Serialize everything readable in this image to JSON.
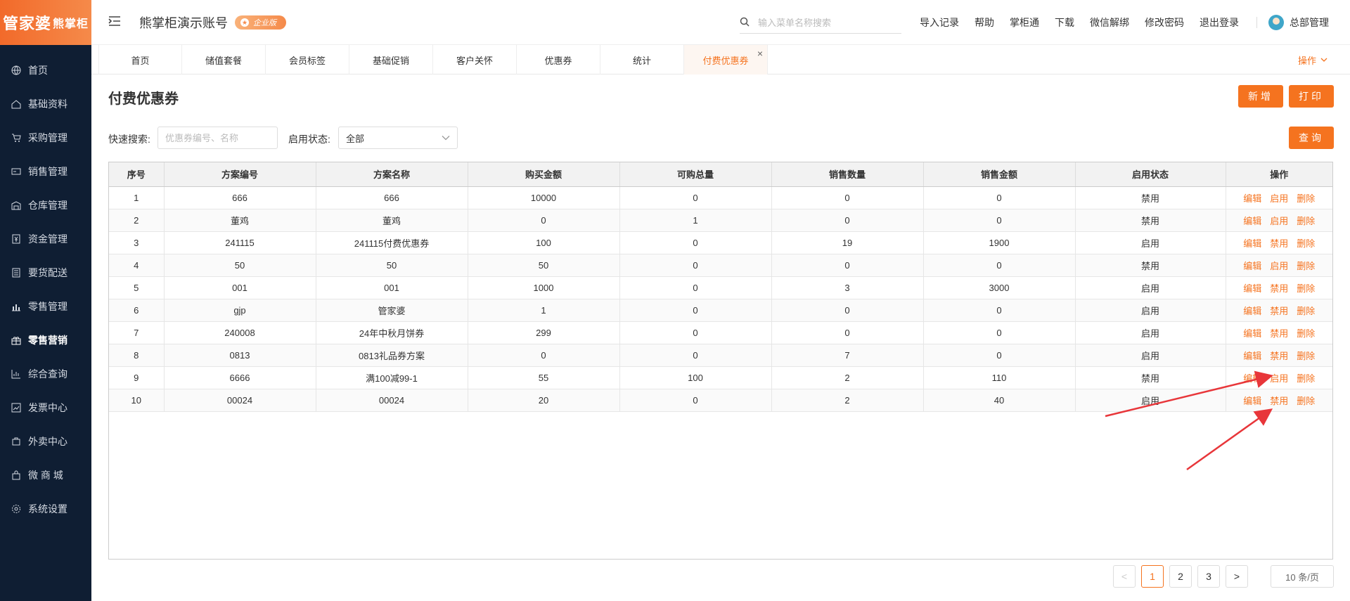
{
  "logo": {
    "main": "管家婆",
    "sub": "熊掌柜"
  },
  "sidebar": {
    "items": [
      {
        "label": "首页",
        "icon": "globe-icon"
      },
      {
        "label": "基础资料",
        "icon": "home-icon"
      },
      {
        "label": "采购管理",
        "icon": "cart-icon"
      },
      {
        "label": "销售管理",
        "icon": "card-icon"
      },
      {
        "label": "仓库管理",
        "icon": "warehouse-icon"
      },
      {
        "label": "资金管理",
        "icon": "money-icon"
      },
      {
        "label": "要货配送",
        "icon": "list-icon"
      },
      {
        "label": "零售管理",
        "icon": "chart-icon"
      },
      {
        "label": "零售营销",
        "icon": "gift-icon",
        "active": true
      },
      {
        "label": "综合查询",
        "icon": "bar-chart-icon"
      },
      {
        "label": "发票中心",
        "icon": "trend-icon"
      },
      {
        "label": "外卖中心",
        "icon": "delivery-icon"
      },
      {
        "label": "微 商 城",
        "icon": "shop-icon"
      },
      {
        "label": "系统设置",
        "icon": "gear-icon"
      }
    ]
  },
  "header": {
    "account": "熊掌柜演示账号",
    "badge": "企业版",
    "search_placeholder": "输入菜单名称搜索",
    "links": [
      "导入记录",
      "帮助",
      "掌柜通",
      "下载",
      "微信解绑",
      "修改密码",
      "退出登录"
    ],
    "user": "总部管理"
  },
  "tabs": {
    "items": [
      "首页",
      "储值套餐",
      "会员标签",
      "基础促销",
      "客户关怀",
      "优惠券",
      "统计",
      "付费优惠券"
    ],
    "active_index": 7,
    "ops_label": "操作"
  },
  "page": {
    "title": "付费优惠券",
    "btn_new": "新增",
    "btn_print": "打印",
    "btn_query": "查询",
    "quick_search_label": "快速搜索:",
    "quick_search_placeholder": "优惠券编号、名称",
    "status_label": "启用状态:",
    "status_value": "全部"
  },
  "table": {
    "headers": [
      "序号",
      "方案编号",
      "方案名称",
      "购买金额",
      "可购总量",
      "销售数量",
      "销售金额",
      "启用状态",
      "操作"
    ],
    "rows": [
      {
        "no": "1",
        "code": "666",
        "name": "666",
        "amount": "10000",
        "total": "0",
        "sold": "0",
        "sales": "0",
        "status": "禁用",
        "actions": [
          "编辑",
          "启用",
          "删除"
        ]
      },
      {
        "no": "2",
        "code": "董鸡",
        "name": "董鸡",
        "amount": "0",
        "total": "1",
        "sold": "0",
        "sales": "0",
        "status": "禁用",
        "actions": [
          "编辑",
          "启用",
          "删除"
        ]
      },
      {
        "no": "3",
        "code": "241115",
        "name": "241115付费优惠券",
        "amount": "100",
        "total": "0",
        "sold": "19",
        "sales": "1900",
        "status": "启用",
        "actions": [
          "编辑",
          "禁用",
          "删除"
        ]
      },
      {
        "no": "4",
        "code": "50",
        "name": "50",
        "amount": "50",
        "total": "0",
        "sold": "0",
        "sales": "0",
        "status": "禁用",
        "actions": [
          "编辑",
          "启用",
          "删除"
        ]
      },
      {
        "no": "5",
        "code": "001",
        "name": "001",
        "amount": "1000",
        "total": "0",
        "sold": "3",
        "sales": "3000",
        "status": "启用",
        "actions": [
          "编辑",
          "禁用",
          "删除"
        ]
      },
      {
        "no": "6",
        "code": "gjp",
        "name": "管家婆",
        "amount": "1",
        "total": "0",
        "sold": "0",
        "sales": "0",
        "status": "启用",
        "actions": [
          "编辑",
          "禁用",
          "删除"
        ]
      },
      {
        "no": "7",
        "code": "240008",
        "name": "24年中秋月饼券",
        "amount": "299",
        "total": "0",
        "sold": "0",
        "sales": "0",
        "status": "启用",
        "actions": [
          "编辑",
          "禁用",
          "删除"
        ]
      },
      {
        "no": "8",
        "code": "0813",
        "name": "0813礼品券方案",
        "amount": "0",
        "total": "0",
        "sold": "7",
        "sales": "0",
        "status": "启用",
        "actions": [
          "编辑",
          "禁用",
          "删除"
        ]
      },
      {
        "no": "9",
        "code": "6666",
        "name": "满100减99-1",
        "amount": "55",
        "total": "100",
        "sold": "2",
        "sales": "110",
        "status": "禁用",
        "actions": [
          "编辑",
          "启用",
          "删除"
        ]
      },
      {
        "no": "10",
        "code": "00024",
        "name": "00024",
        "amount": "20",
        "total": "0",
        "sold": "2",
        "sales": "40",
        "status": "启用",
        "actions": [
          "编辑",
          "禁用",
          "删除"
        ]
      }
    ]
  },
  "pagination": {
    "pages": [
      "1",
      "2",
      "3"
    ],
    "current": "1",
    "prev": "<",
    "next": ">",
    "page_size": "10 条/页"
  },
  "colors": {
    "accent": "#f5731f",
    "sidebar_bg": "#0f1e33",
    "arrow": "#e8363a"
  }
}
